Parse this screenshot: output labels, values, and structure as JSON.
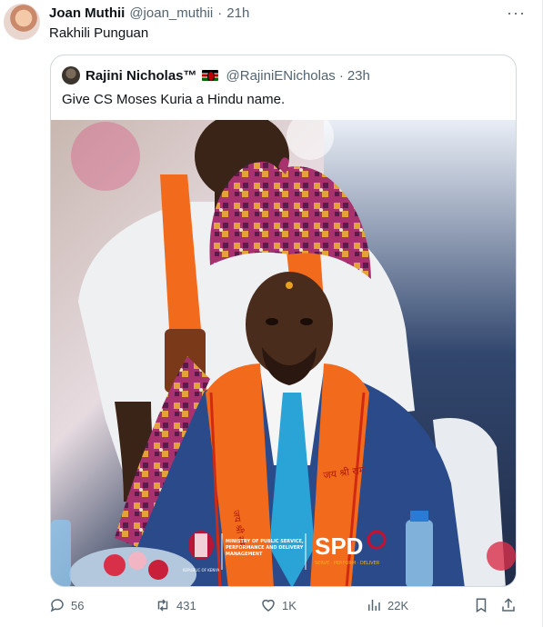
{
  "tweet": {
    "author_name": "Joan Muthii",
    "author_handle": "@joan_muthii",
    "separator": "·",
    "time": "21h",
    "more_label": "···",
    "text": "Rakhili Punguan"
  },
  "quote": {
    "author_name": "Rajini Nicholas™",
    "author_handle": "@RajiniENicholas",
    "separator": "·",
    "time": "23h",
    "text": "Give CS Moses Kuria a Hindu name.",
    "photo": {
      "emblem_text": "REPUBLIC OF KENYA",
      "ministry_text_line1": "MINISTRY OF PUBLIC SERVICE,",
      "ministry_text_line2": "PERFORMANCE AND DELIVERY",
      "ministry_text_line3": "MANAGEMENT",
      "logo_text": "SPD",
      "logo_tagline": "SERVE · PERFORM · DELIVER",
      "scarf_text": "जय श्री राम"
    }
  },
  "actions": {
    "replies": "56",
    "retweets": "431",
    "likes": "1K",
    "views": "22K"
  },
  "colors": {
    "scarf_orange": "#f26a1b",
    "turban_pink": "#a8326e",
    "suit_blue": "#2a4a8a",
    "tie_blue": "#2aa3d6",
    "spd_red": "#c8102e"
  }
}
